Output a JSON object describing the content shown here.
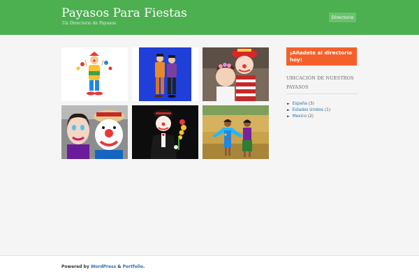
{
  "header": {
    "title": "Payasos Para Fiestas",
    "description": "Un Directorio de Payasos",
    "nav_label": "Directorio",
    "color": "#4caf50"
  },
  "gallery": {
    "photos": [
      {
        "icon": "clown-juggling-photo"
      },
      {
        "icon": "two-clowns-blue-background-photo"
      },
      {
        "icon": "clown-with-girl-photo"
      },
      {
        "icon": "clown-face-paint-couple-photo"
      },
      {
        "icon": "clown-with-flower-photo"
      },
      {
        "icon": "clowns-outdoor-party-photo"
      }
    ]
  },
  "sidebar": {
    "cta_label": "¡Añadete al directorio hoy!",
    "cta_color": "#f4602a",
    "widget_title": "UBICACIÓN DE NUESTROS PAYASOS",
    "categories": [
      {
        "name": "España",
        "count": "(3)"
      },
      {
        "name": "Estados Unidos",
        "count": "(1)"
      },
      {
        "name": "Mexico",
        "count": "(2)"
      }
    ]
  },
  "footer": {
    "prefix": "Powered by",
    "link1": "WordPress",
    "separator": "&",
    "link2": "Portfolio",
    "suffix": "."
  }
}
